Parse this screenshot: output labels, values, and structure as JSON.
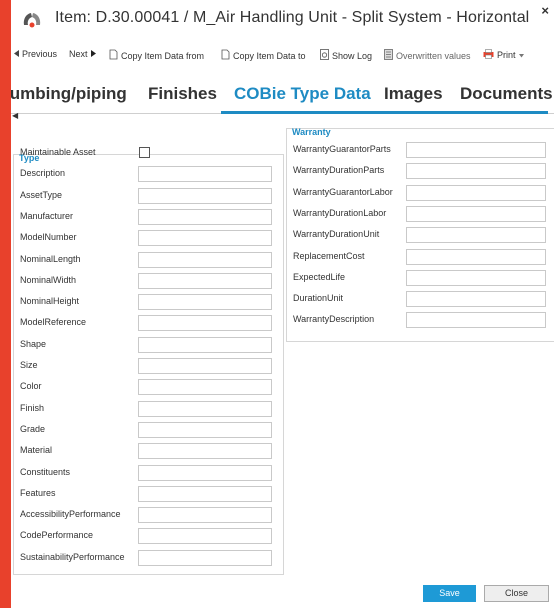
{
  "window": {
    "title": "Item: D.30.00041 / M_Air Handling Unit - Split System - Horizontal",
    "close_glyph": "×"
  },
  "toolbar": {
    "previous": "Previous",
    "next": "Next",
    "copy_from": "Copy Item Data from",
    "copy_to": "Copy Item Data to",
    "show_log": "Show Log",
    "overwritten": "Overwritten values",
    "print": "Print"
  },
  "tabs": [
    {
      "label": "lumbing/piping"
    },
    {
      "label": "Finishes"
    },
    {
      "label": "COBie Type Data"
    },
    {
      "label": "Images"
    },
    {
      "label": "Documents"
    }
  ],
  "type_group": {
    "title": "Type",
    "fields": [
      {
        "label": "Maintainable Asset",
        "value": ""
      },
      {
        "label": "Description",
        "value": ""
      },
      {
        "label": "AssetType",
        "value": ""
      },
      {
        "label": "Manufacturer",
        "value": ""
      },
      {
        "label": "ModelNumber",
        "value": ""
      },
      {
        "label": "NominalLength",
        "value": ""
      },
      {
        "label": "NominalWidth",
        "value": ""
      },
      {
        "label": "NominalHeight",
        "value": ""
      },
      {
        "label": "ModelReference",
        "value": ""
      },
      {
        "label": "Shape",
        "value": ""
      },
      {
        "label": "Size",
        "value": ""
      },
      {
        "label": "Color",
        "value": ""
      },
      {
        "label": "Finish",
        "value": ""
      },
      {
        "label": "Grade",
        "value": ""
      },
      {
        "label": "Material",
        "value": ""
      },
      {
        "label": "Constituents",
        "value": ""
      },
      {
        "label": "Features",
        "value": ""
      },
      {
        "label": "AccessibilityPerformance",
        "value": ""
      },
      {
        "label": "CodePerformance",
        "value": ""
      },
      {
        "label": "SustainabilityPerformance",
        "value": ""
      }
    ]
  },
  "warranty_group": {
    "title": "Warranty",
    "fields": [
      {
        "label": "WarrantyGuarantorParts",
        "value": ""
      },
      {
        "label": "WarrantyDurationParts",
        "value": ""
      },
      {
        "label": "WarrantyGuarantorLabor",
        "value": ""
      },
      {
        "label": "WarrantyDurationLabor",
        "value": ""
      },
      {
        "label": "WarrantyDurationUnit",
        "value": ""
      },
      {
        "label": "ReplacementCost",
        "value": ""
      },
      {
        "label": "ExpectedLife",
        "value": ""
      },
      {
        "label": "DurationUnit",
        "value": ""
      },
      {
        "label": "WarrantyDescription",
        "value": ""
      }
    ]
  },
  "buttons": {
    "save": "Save",
    "close": "Close"
  },
  "colors": {
    "accent": "#1e8bc3",
    "frame": "#e8412c",
    "primary_button": "#1e9ad6"
  }
}
